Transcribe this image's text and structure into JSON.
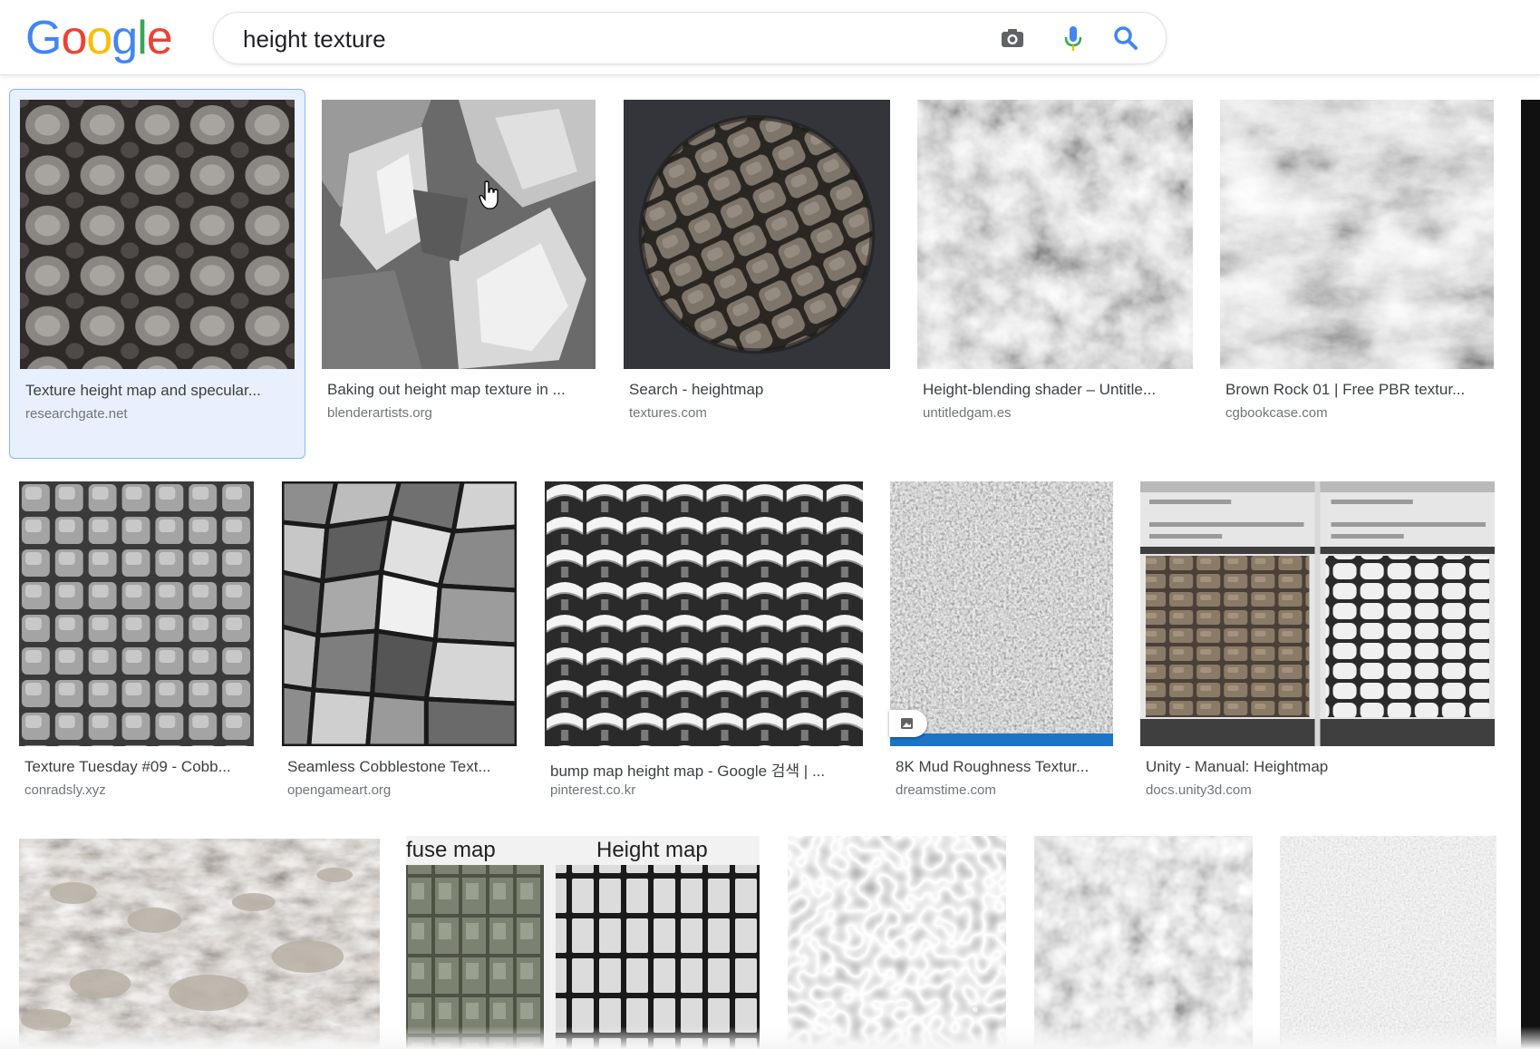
{
  "search": {
    "query": "height texture"
  },
  "logo": {
    "letters": [
      "G",
      "o",
      "o",
      "g",
      "l",
      "e"
    ],
    "colors": [
      "#4285F4",
      "#EA4335",
      "#FBBC05",
      "#4285F4",
      "#34A853",
      "#EA4335"
    ]
  },
  "icons": {
    "camera": "camera-icon",
    "mic": "microphone-icon",
    "search": "search-icon"
  },
  "results": [
    {
      "title": "Texture height map and specular...",
      "domain": "researchgate.net",
      "selected": true
    },
    {
      "title": "Baking out height map texture in ...",
      "domain": "blenderartists.org"
    },
    {
      "title": "Search - heightmap",
      "domain": "textures.com"
    },
    {
      "title": "Height-blending shader – Untitle...",
      "domain": "untitledgam.es"
    },
    {
      "title": "Brown Rock 01 | Free PBR textur...",
      "domain": "cgbookcase.com"
    },
    {
      "title": "Texture Tuesday #09 - Cobb...",
      "domain": "conradsly.xyz"
    },
    {
      "title": "Seamless Cobblestone Text...",
      "domain": "opengameart.org"
    },
    {
      "title": "bump map height map - Google 검색 | ...",
      "domain": "pinterest.co.kr"
    },
    {
      "title": "8K Mud Roughness Textur...",
      "domain": "dreamstime.com"
    },
    {
      "title": "Unity - Manual: Heightmap",
      "domain": "docs.unity3d.com"
    }
  ],
  "row3_image_text": {
    "left": "fuse map",
    "right": "Height map"
  }
}
